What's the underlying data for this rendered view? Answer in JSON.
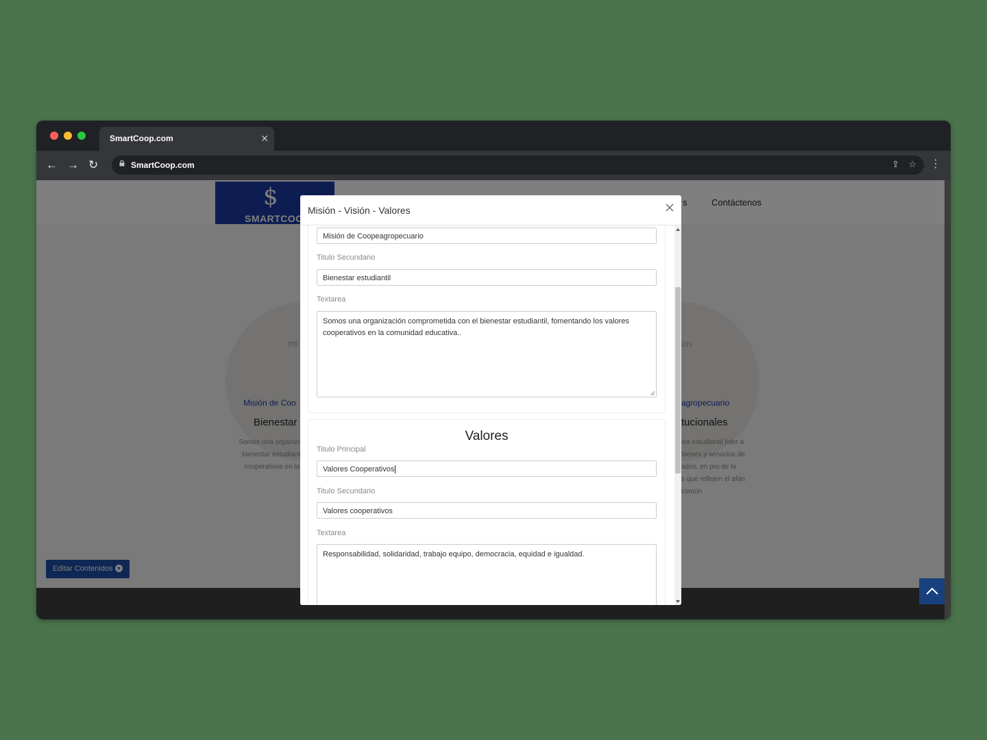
{
  "browser": {
    "tab_title": "SmartCoop.com",
    "url": "SmartCoop.com"
  },
  "site": {
    "logo_text": "SMARTCOO",
    "nav_partial": "s",
    "nav_contact": "Contáctenos",
    "card_left": {
      "watermark": "mi",
      "subtitle": "Misión de Coo",
      "title": "Bienestar",
      "text_lines": [
        "Somos una organizac",
        "bienestar estudiantil,",
        "cooperativos en la c"
      ]
    },
    "card_right": {
      "watermark": "on",
      "subtitle": "agropecuario",
      "title": "tucionales",
      "text_lines": [
        "iva estudiantil líder a",
        "bienes y servicios de",
        "ados, en pro de la",
        "s que reflejen el afán",
        "común"
      ]
    },
    "edit_button": "Editar Contenidos"
  },
  "modal": {
    "title": "Misión - Visión - Valores",
    "mision": {
      "titulo_principal_value": "Misión de Coopeagropecuario",
      "titulo_secundario_label": "Titulo Secundario",
      "titulo_secundario_value": "Bienestar estudiantil",
      "textarea_label": "Textarea",
      "textarea_value": "Somos una organización comprometida con el bienestar estudiantil, fomentando los valores cooperativos en la comunidad educativa.."
    },
    "valores": {
      "heading": "Valores",
      "titulo_principal_label": "Titulo Principal",
      "titulo_principal_value": "Valores Cooperativos",
      "titulo_secundario_label": "Titulo Secundario",
      "titulo_secundario_value": "Valores cooperativos",
      "textarea_label": "Textarea",
      "textarea_value": "Responsabilidad, solidaridad, trabajo equipo, democracia, equidad e igualdad."
    }
  }
}
